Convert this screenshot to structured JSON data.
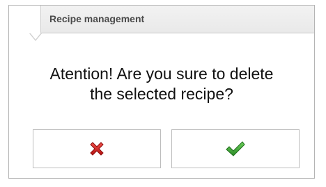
{
  "dialog": {
    "title": "Recipe management",
    "message_line1": "Atention! Are you sure to delete",
    "message_line2": "the selected recipe?"
  },
  "buttons": {
    "cancel": {
      "icon": "red-x-icon",
      "color": "#d91e1e"
    },
    "confirm": {
      "icon": "green-check-icon",
      "color": "#3aa335"
    }
  }
}
